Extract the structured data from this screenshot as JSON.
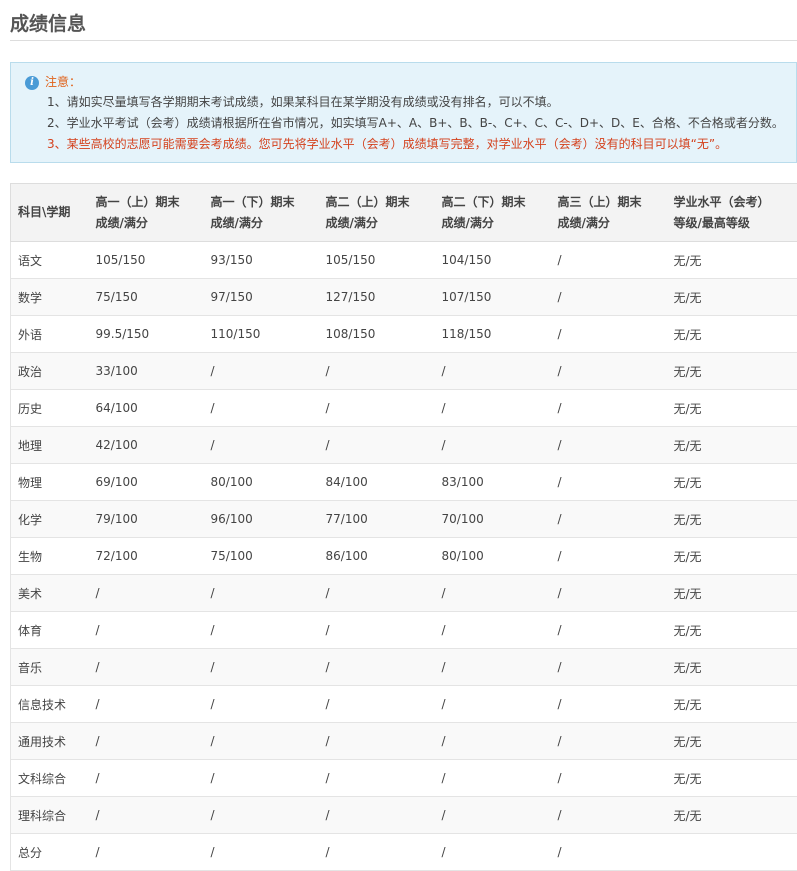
{
  "page_title": "成绩信息",
  "notice": {
    "label": "注意：",
    "lines": [
      "1、请如实尽量填写各学期期末考试成绩，如果某科目在某学期没有成绩或没有排名，可以不填。",
      "2、学业水平考试（会考）成绩请根据所在省市情况，如实填写A+、A、B+、B、B-、C+、C、C-、D+、D、E、合格、不合格或者分数。",
      "3、某些高校的志愿可能需要会考成绩。您可先将学业水平（会考）成绩填写完整，对学业水平（会考）没有的科目可以填“无”。"
    ]
  },
  "table": {
    "headers": [
      [
        "科目\\学期"
      ],
      [
        "高一（上）期末",
        "成绩/满分"
      ],
      [
        "高一（下）期末",
        "成绩/满分"
      ],
      [
        "高二（上）期末",
        "成绩/满分"
      ],
      [
        "高二（下）期末",
        "成绩/满分"
      ],
      [
        "高三（上）期末",
        "成绩/满分"
      ],
      [
        "学业水平（会考）",
        "等级/最高等级"
      ]
    ],
    "rows": [
      [
        "语文",
        "105/150",
        "93/150",
        "105/150",
        "104/150",
        "/",
        "无/无"
      ],
      [
        "数学",
        "75/150",
        "97/150",
        "127/150",
        "107/150",
        "/",
        "无/无"
      ],
      [
        "外语",
        "99.5/150",
        "110/150",
        "108/150",
        "118/150",
        "/",
        "无/无"
      ],
      [
        "政治",
        "33/100",
        "/",
        "/",
        "/",
        "/",
        "无/无"
      ],
      [
        "历史",
        "64/100",
        "/",
        "/",
        "/",
        "/",
        "无/无"
      ],
      [
        "地理",
        "42/100",
        "/",
        "/",
        "/",
        "/",
        "无/无"
      ],
      [
        "物理",
        "69/100",
        "80/100",
        "84/100",
        "83/100",
        "/",
        "无/无"
      ],
      [
        "化学",
        "79/100",
        "96/100",
        "77/100",
        "70/100",
        "/",
        "无/无"
      ],
      [
        "生物",
        "72/100",
        "75/100",
        "86/100",
        "80/100",
        "/",
        "无/无"
      ],
      [
        "美术",
        "/",
        "/",
        "/",
        "/",
        "/",
        "无/无"
      ],
      [
        "体育",
        "/",
        "/",
        "/",
        "/",
        "/",
        "无/无"
      ],
      [
        "音乐",
        "/",
        "/",
        "/",
        "/",
        "/",
        "无/无"
      ],
      [
        "信息技术",
        "/",
        "/",
        "/",
        "/",
        "/",
        "无/无"
      ],
      [
        "通用技术",
        "/",
        "/",
        "/",
        "/",
        "/",
        "无/无"
      ],
      [
        "文科综合",
        "/",
        "/",
        "/",
        "/",
        "/",
        "无/无"
      ],
      [
        "理科综合",
        "/",
        "/",
        "/",
        "/",
        "/",
        "无/无"
      ],
      [
        "总分",
        "/",
        "/",
        "/",
        "/",
        "/",
        ""
      ]
    ]
  }
}
